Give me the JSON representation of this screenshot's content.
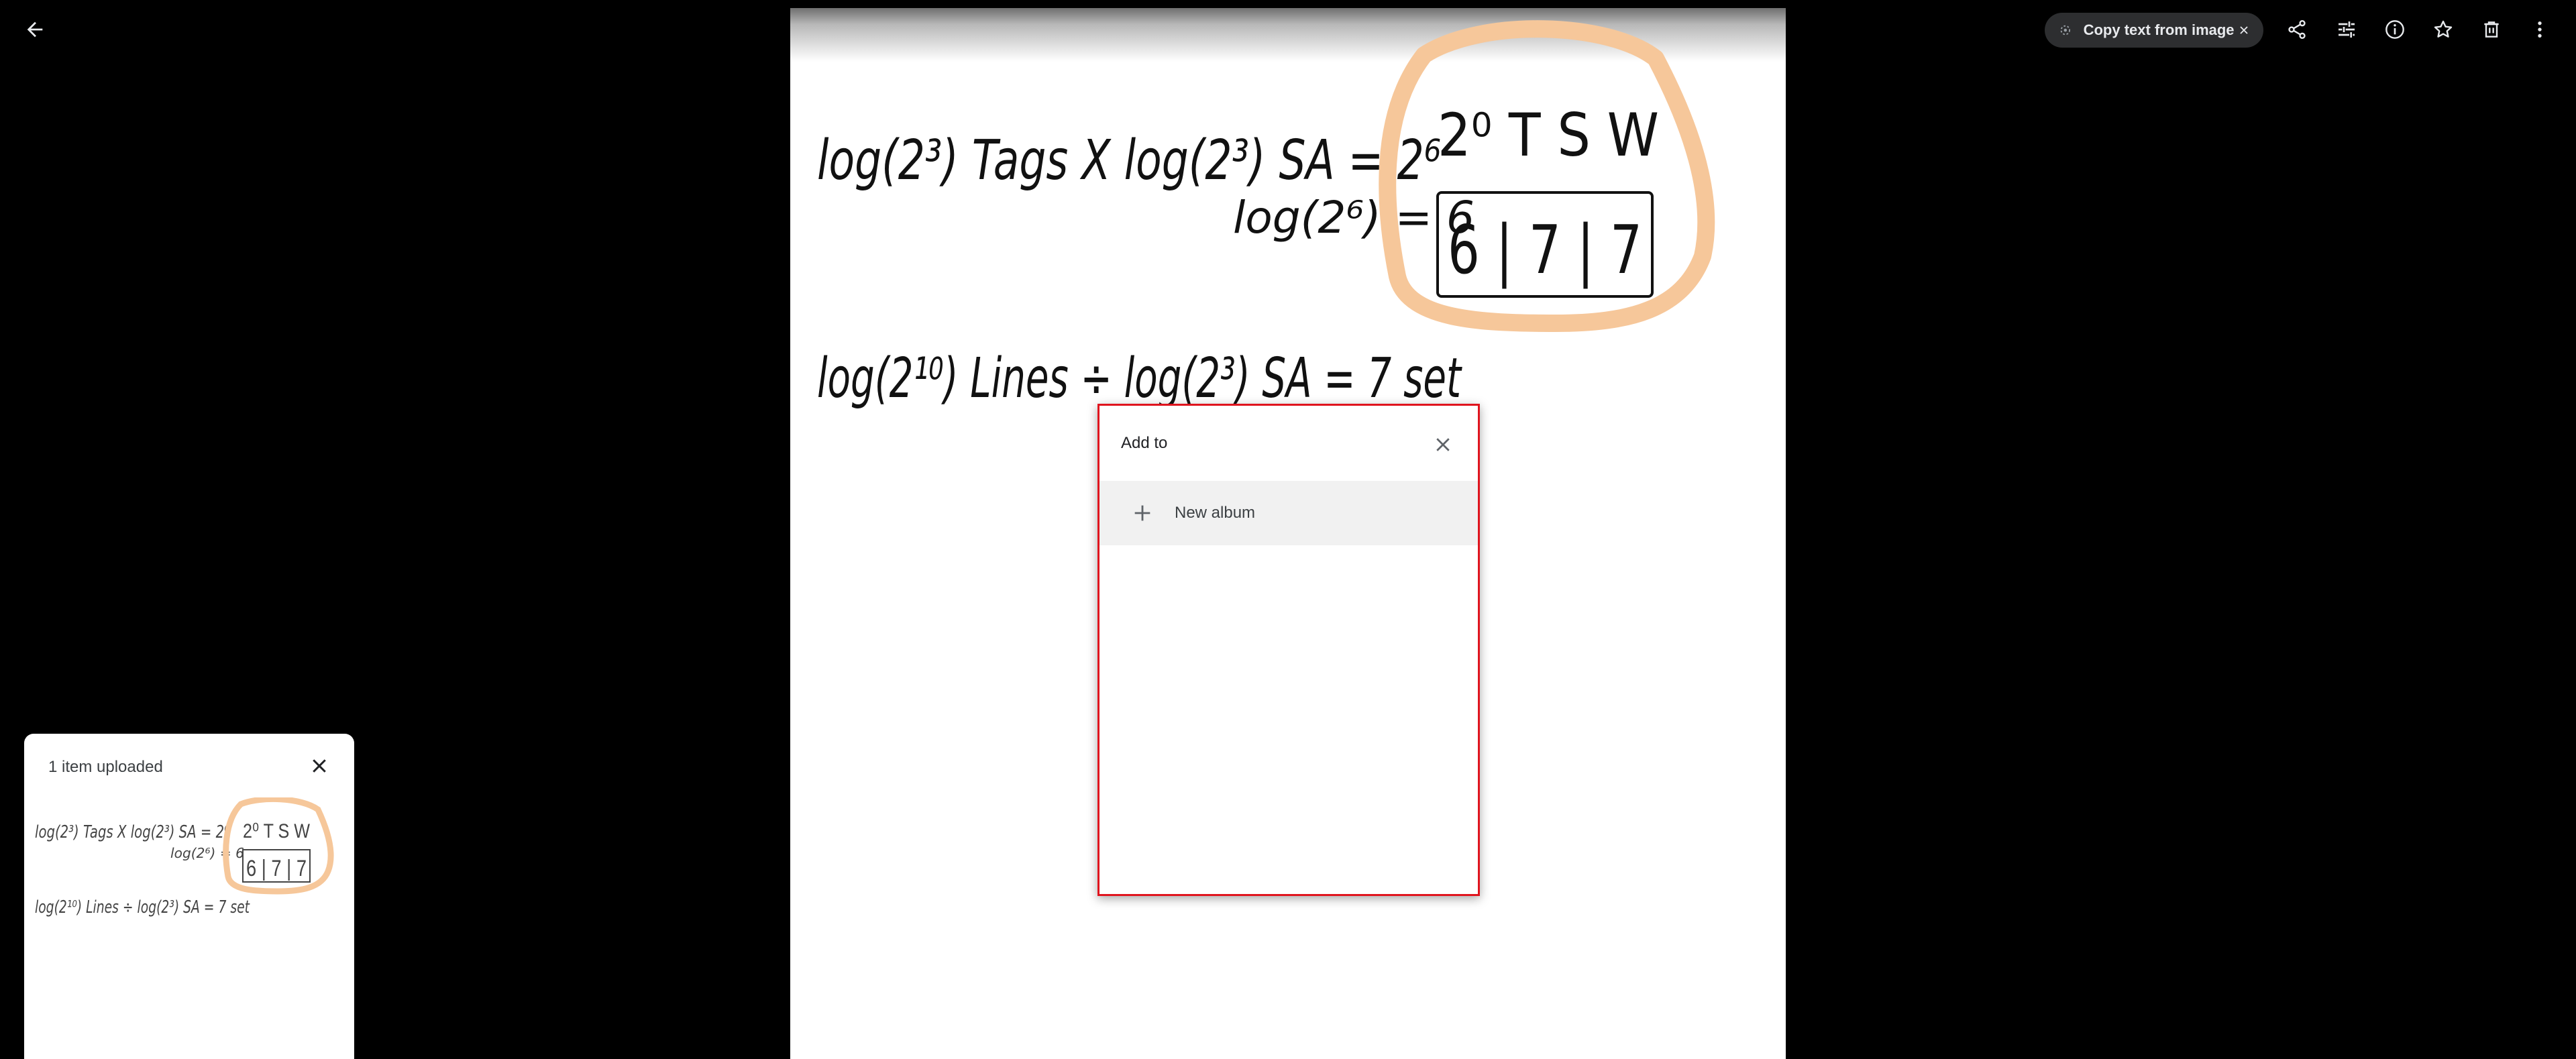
{
  "topbar": {
    "back_icon": "arrow-back-icon",
    "copy_text_label": "Copy text from image",
    "tools": [
      "share-icon",
      "edit-adjust-icon",
      "info-icon",
      "star-icon",
      "delete-icon",
      "more-vert-icon"
    ]
  },
  "photo": {
    "line1": "log(2³) Tags X log(2³) SA = 2⁶",
    "line2": "log(2⁶) = 6",
    "line3": "log(2¹⁰) Lines ÷ log(2³) SA = 7 set",
    "box_top": "2⁰  T S W",
    "box_bottom": "6 | 7 | 7",
    "highlight_color": "#f6c79a"
  },
  "dialog": {
    "title": "Add to",
    "new_album_label": "New album"
  },
  "upload": {
    "title": "1 item uploaded"
  },
  "colors": {
    "dialog_border": "#e0141e",
    "chip_bg": "#2d2e30"
  }
}
